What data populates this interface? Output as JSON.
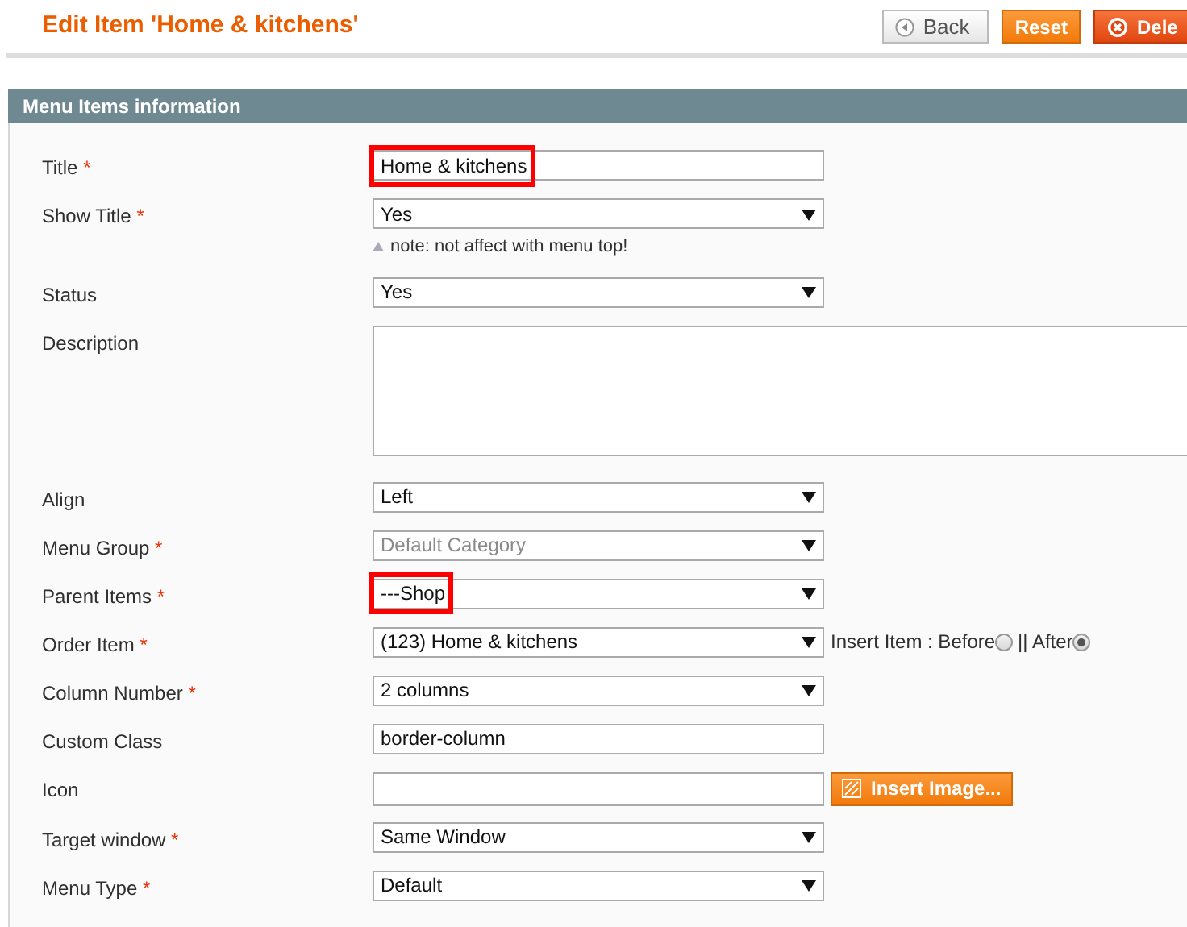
{
  "page_title": "Edit Item 'Home & kitchens'",
  "buttons": [
    {
      "label": "Back",
      "kind": "back"
    },
    {
      "label": "Reset",
      "kind": "reset"
    },
    {
      "label": "Dele",
      "kind": "delete"
    }
  ],
  "section": {
    "title": "Menu Items information"
  },
  "fields": [
    {
      "label": "Title",
      "mark": "*",
      "kind": "text",
      "value": "Home & kitchens",
      "highlight": true
    },
    {
      "label": "Show Title",
      "mark": "*",
      "kind": "select",
      "value": "Yes",
      "disabled": false,
      "note": "note: not affect with menu top!"
    },
    {
      "label": "Status",
      "kind": "select",
      "value": "Yes",
      "disabled": false
    },
    {
      "label": "Description",
      "kind": "textarea"
    },
    {
      "label": "Align",
      "kind": "select",
      "value": "Left",
      "disabled": false
    },
    {
      "label": "Menu Group",
      "mark": "*",
      "kind": "select",
      "value": "Default Category",
      "disabled": true
    },
    {
      "label": "Parent Items",
      "mark": "*",
      "kind": "select",
      "value": "---Shop",
      "disabled": false,
      "highlight": true
    },
    {
      "label": "Order Item",
      "mark": "*",
      "kind": "select",
      "value": "(123) Home & kitchens",
      "disabled": false,
      "insert_options": [
        {
          "label": "Insert Item : Before",
          "selected": false
        },
        {
          "label": "|| After",
          "selected": true
        }
      ]
    },
    {
      "label": "Column Number",
      "mark": "*",
      "kind": "select",
      "value": "2 columns",
      "disabled": false
    },
    {
      "label": "Custom Class",
      "kind": "text",
      "value": "border-column"
    },
    {
      "label": "Icon",
      "kind": "image",
      "button": "Insert Image..."
    },
    {
      "label": "Target window",
      "mark": "*",
      "kind": "select",
      "value": "Same Window",
      "disabled": false
    },
    {
      "label": "Menu Type",
      "mark": "*",
      "kind": "select",
      "value": "Default",
      "disabled": false
    }
  ]
}
